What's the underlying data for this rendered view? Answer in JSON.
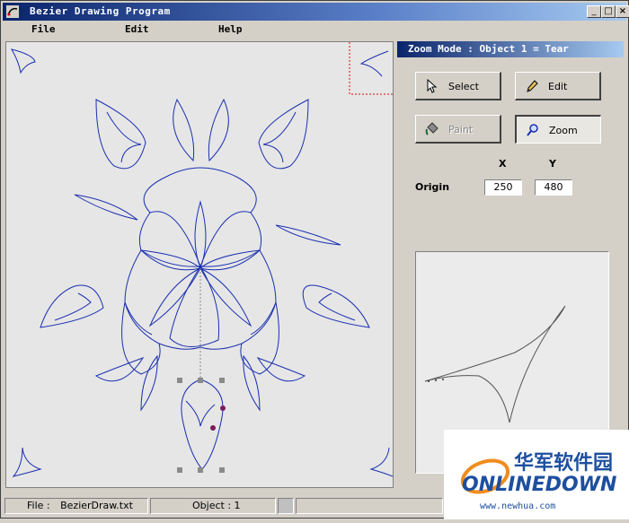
{
  "window": {
    "title": "Bezier Drawing Program"
  },
  "window_buttons": {
    "minimize": "_",
    "maximize": "□",
    "close": "×"
  },
  "menu": {
    "file": "File",
    "edit": "Edit",
    "help": "Help"
  },
  "panel": {
    "mode_title": "Zoom Mode : Object 1 = Tear",
    "buttons": {
      "select": "Select",
      "edit": "Edit",
      "paint": "Paint",
      "zoom": "Zoom"
    },
    "button_icons": {
      "select": "arrow-cursor-icon",
      "edit": "pencil-icon",
      "paint": "paint-bucket-icon",
      "zoom": "magnifier-icon"
    },
    "origin_label": "Origin",
    "x_label": "X",
    "y_label": "Y",
    "x_value": "250",
    "y_value": "480"
  },
  "status": {
    "file_label": "File :",
    "file_name": "BezierDraw.txt",
    "object_label": "Object : 1"
  },
  "watermark": {
    "cn": "华军软件园",
    "brand": "ONLINEDOWN",
    "url": "www.newhua.com"
  },
  "colors": {
    "title_start": "#0a246a",
    "title_end": "#a6caf0",
    "curve": "#1a2fb0",
    "handle": "#8a8a8a",
    "accent_point": "#7a1a5a",
    "wm_orange": "#f08c1e",
    "wm_blue": "#1d4fa0"
  }
}
